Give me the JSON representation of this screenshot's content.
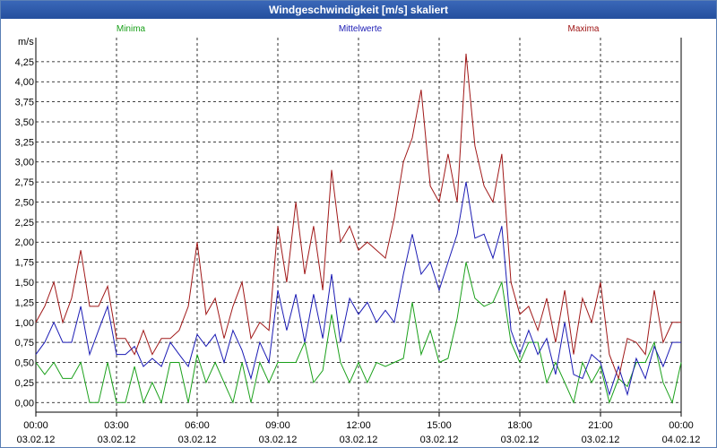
{
  "window": {
    "title": "Windgeschwindigkeit [m/s] skaliert"
  },
  "colors": {
    "minima": "#1aa01a",
    "mittelwerte": "#1b1bb4",
    "maxima": "#a01818",
    "titlebar": "#2e5aab"
  },
  "chart_data": {
    "type": "line",
    "title": "Windgeschwindigkeit [m/s] skaliert",
    "ylabel": "m/s",
    "ylim": [
      -0.12,
      4.55
    ],
    "yticks": [
      "0,00",
      "0,25",
      "0,50",
      "0,75",
      "1,00",
      "1,25",
      "1,50",
      "1,75",
      "2,00",
      "2,25",
      "2,50",
      "2,75",
      "3,00",
      "3,25",
      "3,50",
      "3,75",
      "4,00",
      "4,25"
    ],
    "ytick_values": [
      0,
      0.25,
      0.5,
      0.75,
      1,
      1.25,
      1.5,
      1.75,
      2,
      2.25,
      2.5,
      2.75,
      3,
      3.25,
      3.5,
      3.75,
      4,
      4.25
    ],
    "xlim_hours": [
      0,
      24
    ],
    "xticks": [
      {
        "time": "00:00",
        "date": "03.02.12"
      },
      {
        "time": "03:00",
        "date": "03.02.12"
      },
      {
        "time": "06:00",
        "date": "03.02.12"
      },
      {
        "time": "09:00",
        "date": "03.02.12"
      },
      {
        "time": "12:00",
        "date": "03.02.12"
      },
      {
        "time": "15:00",
        "date": "03.02.12"
      },
      {
        "time": "18:00",
        "date": "03.02.12"
      },
      {
        "time": "21:00",
        "date": "03.02.12"
      },
      {
        "time": "00:00",
        "date": "04.02.12"
      }
    ],
    "grid": true,
    "legend_position": "top",
    "series": [
      {
        "name": "Minima",
        "color": "#1aa01a",
        "points": [
          [
            0,
            0.5
          ],
          [
            0.33,
            0.35
          ],
          [
            0.67,
            0.5
          ],
          [
            1,
            0.3
          ],
          [
            1.33,
            0.3
          ],
          [
            1.67,
            0.5
          ],
          [
            2,
            0
          ],
          [
            2.33,
            0
          ],
          [
            2.67,
            0.5
          ],
          [
            3,
            0
          ],
          [
            3.33,
            0
          ],
          [
            3.67,
            0.45
          ],
          [
            4,
            0
          ],
          [
            4.33,
            0.25
          ],
          [
            4.67,
            0
          ],
          [
            5,
            0.5
          ],
          [
            5.33,
            0.5
          ],
          [
            5.67,
            0
          ],
          [
            6,
            0.6
          ],
          [
            6.33,
            0.25
          ],
          [
            6.67,
            0.5
          ],
          [
            7,
            0.25
          ],
          [
            7.33,
            0
          ],
          [
            7.67,
            0.5
          ],
          [
            8,
            0
          ],
          [
            8.33,
            0.5
          ],
          [
            8.67,
            0.25
          ],
          [
            9,
            0.5
          ],
          [
            9.33,
            0.5
          ],
          [
            9.67,
            0.5
          ],
          [
            10,
            0.75
          ],
          [
            10.33,
            0.25
          ],
          [
            10.67,
            0.4
          ],
          [
            11,
            1.1
          ],
          [
            11.33,
            0.5
          ],
          [
            11.67,
            0.25
          ],
          [
            12,
            0.5
          ],
          [
            12.33,
            0.25
          ],
          [
            12.67,
            0.5
          ],
          [
            13,
            0.45
          ],
          [
            13.33,
            0.5
          ],
          [
            13.67,
            0.55
          ],
          [
            14,
            1.25
          ],
          [
            14.33,
            0.6
          ],
          [
            14.67,
            0.9
          ],
          [
            15,
            0.5
          ],
          [
            15.33,
            0.55
          ],
          [
            15.67,
            1.05
          ],
          [
            16,
            1.75
          ],
          [
            16.33,
            1.3
          ],
          [
            16.67,
            1.2
          ],
          [
            17,
            1.25
          ],
          [
            17.33,
            1.5
          ],
          [
            17.67,
            0.75
          ],
          [
            18,
            0.5
          ],
          [
            18.33,
            0.75
          ],
          [
            18.67,
            0.75
          ],
          [
            19,
            0.25
          ],
          [
            19.33,
            0.5
          ],
          [
            19.67,
            0.25
          ],
          [
            20,
            0
          ],
          [
            20.33,
            0.5
          ],
          [
            20.67,
            0.25
          ],
          [
            21,
            0.45
          ],
          [
            21.33,
            0
          ],
          [
            21.67,
            0.3
          ],
          [
            22,
            0.2
          ],
          [
            22.33,
            0.5
          ],
          [
            22.67,
            0.5
          ],
          [
            23,
            0.75
          ],
          [
            23.33,
            0.25
          ],
          [
            23.67,
            0
          ],
          [
            24,
            0.5
          ]
        ]
      },
      {
        "name": "Mittelwerte",
        "color": "#1b1bb4",
        "points": [
          [
            0,
            0.6
          ],
          [
            0.33,
            0.75
          ],
          [
            0.67,
            1
          ],
          [
            1,
            0.75
          ],
          [
            1.33,
            0.75
          ],
          [
            1.67,
            1.2
          ],
          [
            2,
            0.6
          ],
          [
            2.33,
            0.9
          ],
          [
            2.67,
            1.2
          ],
          [
            3,
            0.6
          ],
          [
            3.33,
            0.6
          ],
          [
            3.67,
            0.7
          ],
          [
            4,
            0.45
          ],
          [
            4.33,
            0.55
          ],
          [
            4.67,
            0.45
          ],
          [
            5,
            0.75
          ],
          [
            5.33,
            0.6
          ],
          [
            5.67,
            0.45
          ],
          [
            6,
            0.85
          ],
          [
            6.33,
            0.7
          ],
          [
            6.67,
            0.85
          ],
          [
            7,
            0.5
          ],
          [
            7.33,
            0.9
          ],
          [
            7.67,
            0.65
          ],
          [
            8,
            0.3
          ],
          [
            8.33,
            0.75
          ],
          [
            8.67,
            0.5
          ],
          [
            9,
            1.4
          ],
          [
            9.33,
            0.9
          ],
          [
            9.67,
            1.35
          ],
          [
            10,
            0.75
          ],
          [
            10.33,
            1.35
          ],
          [
            10.67,
            0.8
          ],
          [
            11,
            1.6
          ],
          [
            11.33,
            0.75
          ],
          [
            11.67,
            1.3
          ],
          [
            12,
            1.1
          ],
          [
            12.33,
            1.25
          ],
          [
            12.67,
            1.0
          ],
          [
            13,
            1.15
          ],
          [
            13.33,
            1.0
          ],
          [
            13.67,
            1.6
          ],
          [
            14,
            2.1
          ],
          [
            14.33,
            1.6
          ],
          [
            14.67,
            1.75
          ],
          [
            15,
            1.4
          ],
          [
            15.33,
            1.75
          ],
          [
            15.67,
            2.1
          ],
          [
            16,
            2.75
          ],
          [
            16.33,
            2.05
          ],
          [
            16.67,
            2.1
          ],
          [
            17,
            1.8
          ],
          [
            17.33,
            2.2
          ],
          [
            17.67,
            0.9
          ],
          [
            18,
            0.6
          ],
          [
            18.33,
            0.9
          ],
          [
            18.67,
            0.6
          ],
          [
            19,
            0.8
          ],
          [
            19.33,
            0.35
          ],
          [
            19.67,
            1.0
          ],
          [
            20,
            0.35
          ],
          [
            20.33,
            0.3
          ],
          [
            20.67,
            0.6
          ],
          [
            21,
            0.5
          ],
          [
            21.33,
            0.1
          ],
          [
            21.67,
            0.45
          ],
          [
            22,
            0.1
          ],
          [
            22.33,
            0.55
          ],
          [
            22.67,
            0.3
          ],
          [
            23,
            0.7
          ],
          [
            23.33,
            0.45
          ],
          [
            23.67,
            0.75
          ],
          [
            24,
            0.75
          ]
        ]
      },
      {
        "name": "Maxima",
        "color": "#a01818",
        "points": [
          [
            0,
            1
          ],
          [
            0.33,
            1.2
          ],
          [
            0.67,
            1.5
          ],
          [
            1,
            1
          ],
          [
            1.33,
            1.3
          ],
          [
            1.67,
            1.9
          ],
          [
            2,
            1.2
          ],
          [
            2.33,
            1.2
          ],
          [
            2.67,
            1.45
          ],
          [
            3,
            0.8
          ],
          [
            3.33,
            0.8
          ],
          [
            3.67,
            0.6
          ],
          [
            4,
            0.9
          ],
          [
            4.33,
            0.6
          ],
          [
            4.67,
            0.8
          ],
          [
            5,
            0.8
          ],
          [
            5.33,
            0.9
          ],
          [
            5.67,
            1.2
          ],
          [
            6,
            2.0
          ],
          [
            6.33,
            1.1
          ],
          [
            6.67,
            1.3
          ],
          [
            7,
            0.8
          ],
          [
            7.33,
            1.2
          ],
          [
            7.67,
            1.5
          ],
          [
            8,
            0.8
          ],
          [
            8.33,
            1.0
          ],
          [
            8.67,
            0.9
          ],
          [
            9,
            2.2
          ],
          [
            9.33,
            1.5
          ],
          [
            9.67,
            2.5
          ],
          [
            10,
            1.6
          ],
          [
            10.33,
            2.2
          ],
          [
            10.67,
            1.4
          ],
          [
            11,
            2.9
          ],
          [
            11.33,
            2.0
          ],
          [
            11.67,
            2.2
          ],
          [
            12,
            1.9
          ],
          [
            12.33,
            2.0
          ],
          [
            12.67,
            1.9
          ],
          [
            13,
            1.8
          ],
          [
            13.33,
            2.3
          ],
          [
            13.67,
            3.0
          ],
          [
            14,
            3.3
          ],
          [
            14.33,
            3.9
          ],
          [
            14.67,
            2.7
          ],
          [
            15,
            2.5
          ],
          [
            15.33,
            3.1
          ],
          [
            15.67,
            2.5
          ],
          [
            16,
            4.35
          ],
          [
            16.33,
            3.2
          ],
          [
            16.67,
            2.7
          ],
          [
            17,
            2.5
          ],
          [
            17.33,
            3.1
          ],
          [
            17.67,
            1.5
          ],
          [
            18,
            1.1
          ],
          [
            18.33,
            1.2
          ],
          [
            18.67,
            0.9
          ],
          [
            19,
            1.3
          ],
          [
            19.33,
            0.75
          ],
          [
            19.67,
            1.4
          ],
          [
            20,
            0.6
          ],
          [
            20.33,
            1.3
          ],
          [
            20.67,
            1.0
          ],
          [
            21,
            1.5
          ],
          [
            21.33,
            0.6
          ],
          [
            21.67,
            0.3
          ],
          [
            22,
            0.8
          ],
          [
            22.33,
            0.75
          ],
          [
            22.67,
            0.6
          ],
          [
            23,
            1.4
          ],
          [
            23.33,
            0.75
          ],
          [
            23.67,
            1.0
          ],
          [
            24,
            1.0
          ]
        ]
      }
    ]
  }
}
